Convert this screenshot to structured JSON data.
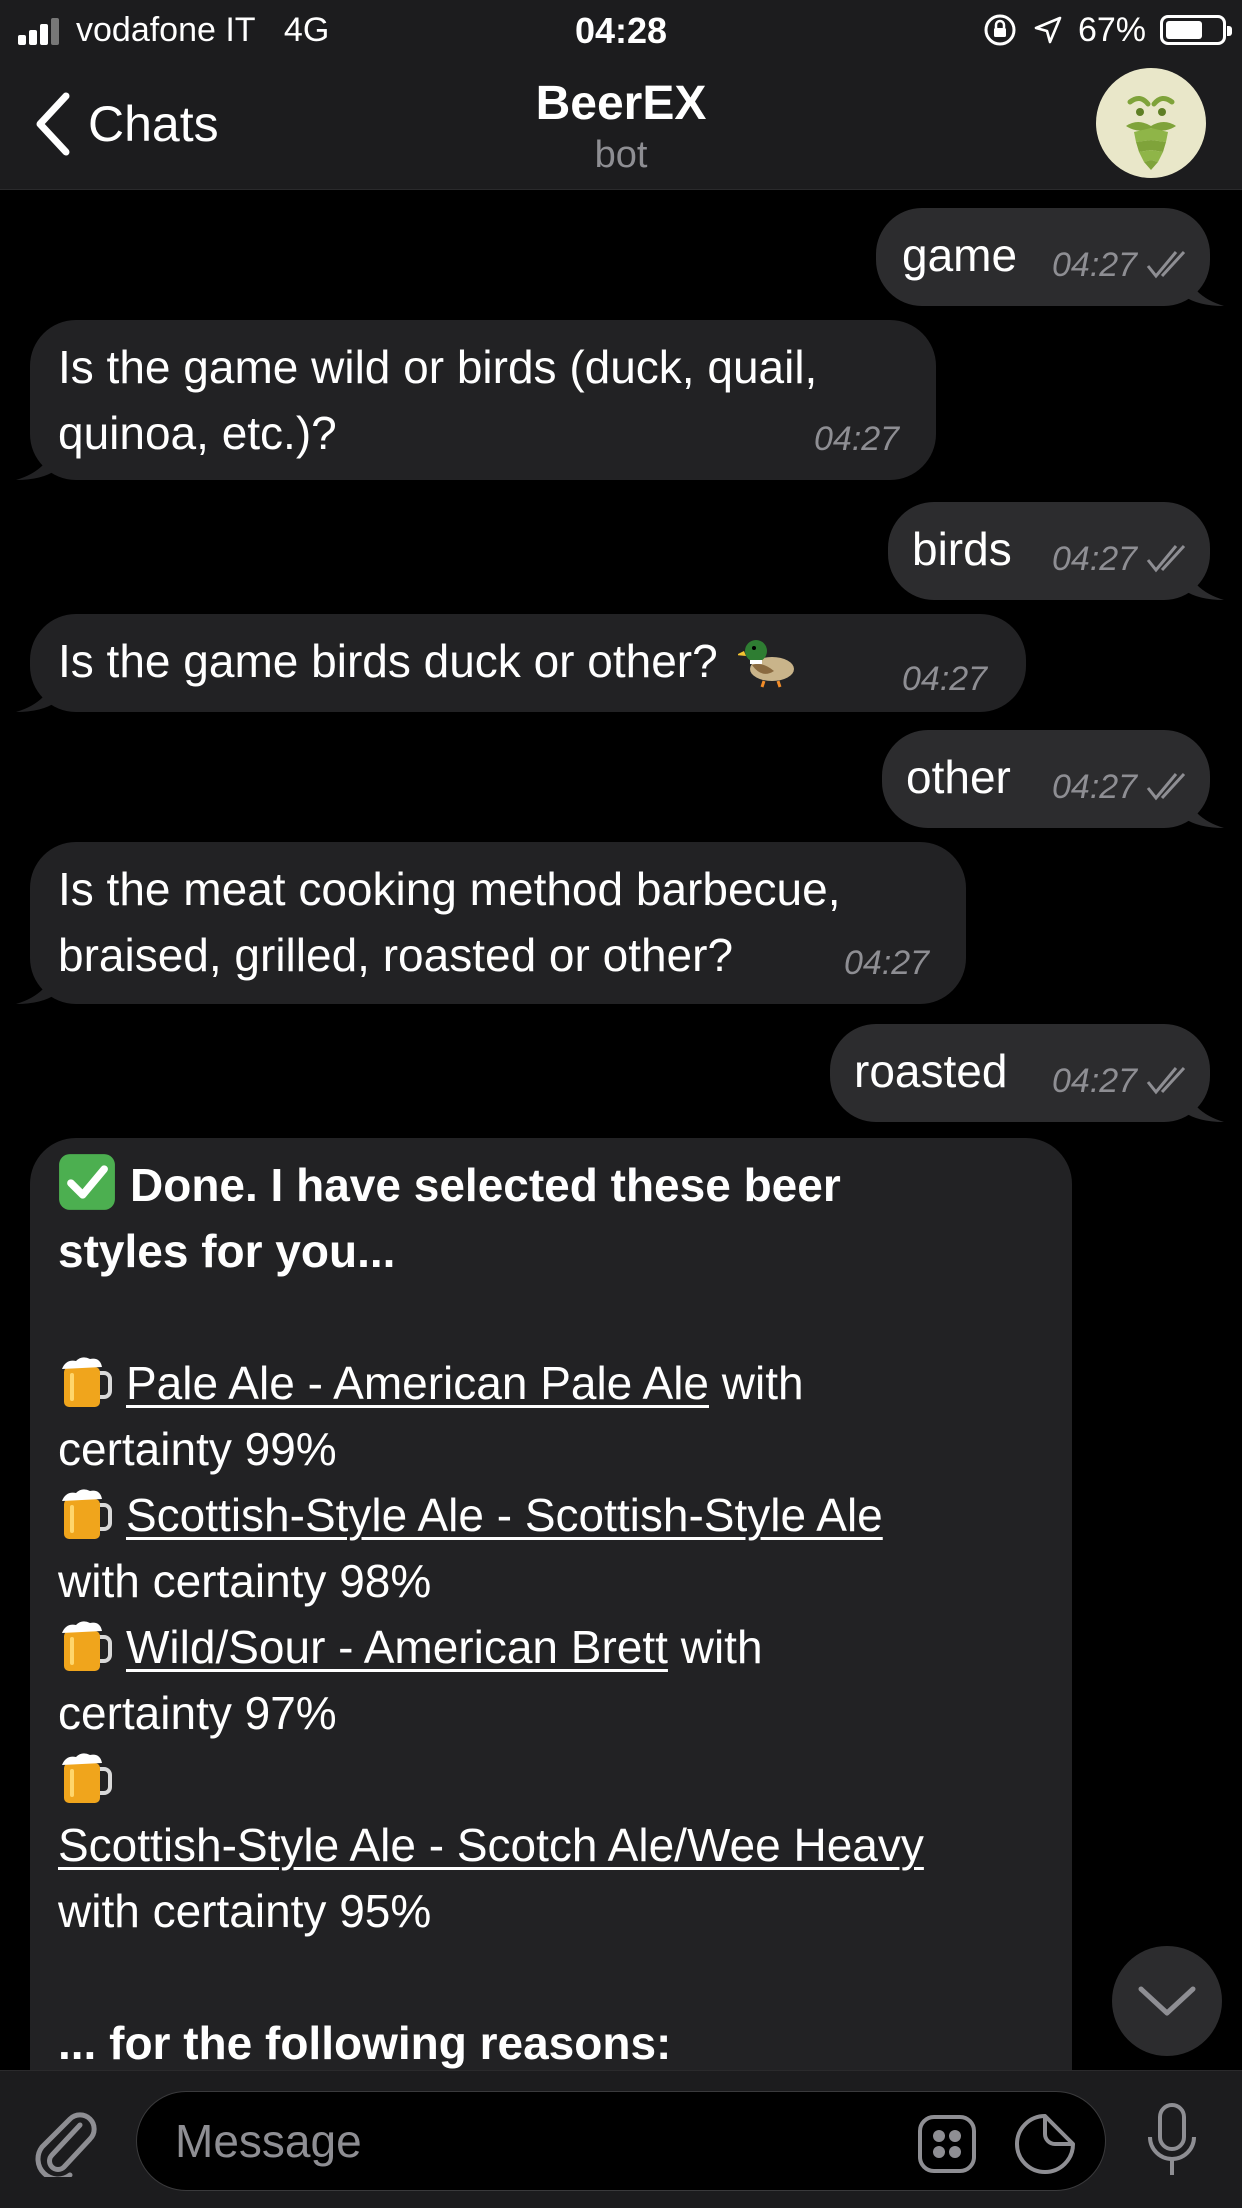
{
  "status_bar": {
    "carrier": "vodafone IT",
    "network": "4G",
    "time": "04:28",
    "battery": "67%",
    "battery_level": 0.67
  },
  "header": {
    "back_label": "Chats",
    "title": "BeerEX",
    "subtitle": "bot",
    "avatar_icon": "hop-beard-icon"
  },
  "messages": [
    {
      "direction": "out",
      "text": "game",
      "time": "04:27",
      "read": true
    },
    {
      "direction": "in",
      "lines": [
        "Is the game wild or birds (duck, quail,",
        "quinoa, etc.)?"
      ],
      "time": "04:27"
    },
    {
      "direction": "out",
      "text": "birds",
      "time": "04:27",
      "read": true
    },
    {
      "direction": "in",
      "text": "Is the game birds duck or other?",
      "emoji": "duck-emoji",
      "time": "04:27"
    },
    {
      "direction": "out",
      "text": "other",
      "time": "04:27",
      "read": true
    },
    {
      "direction": "in",
      "lines": [
        "Is the meat cooking method barbecue,",
        "braised, grilled, roasted or other?"
      ],
      "time": "04:27"
    },
    {
      "direction": "out",
      "text": "roasted",
      "time": "04:27",
      "read": true
    }
  ],
  "result": {
    "heading_line1": "Done. I have selected these beer",
    "heading_line2": "styles for you...",
    "items": [
      {
        "link": "Pale Ale - American Pale Ale",
        "suffix": " with",
        "line2": "certainty 99%"
      },
      {
        "link": "Scottish-Style Ale - Scottish-Style Ale",
        "suffix": "",
        "line2": "with certainty 98%"
      },
      {
        "link": "Wild/Sour - American Brett",
        "suffix": " with",
        "line2": "certainty 97%"
      },
      {
        "link": "Scottish-Style Ale - Scotch Ale/Wee Heavy",
        "suffix": "",
        "line2": "with certainty 95%"
      }
    ],
    "reasons_heading": "... for the following reasons:"
  },
  "input": {
    "placeholder": "Message"
  },
  "colors": {
    "background": "#000000",
    "bar": "#1c1c1e",
    "bubble_in": "#222224",
    "bubble_out": "#2c2c2e",
    "meta": "#8e8e93",
    "check_green": "#4caf50"
  }
}
